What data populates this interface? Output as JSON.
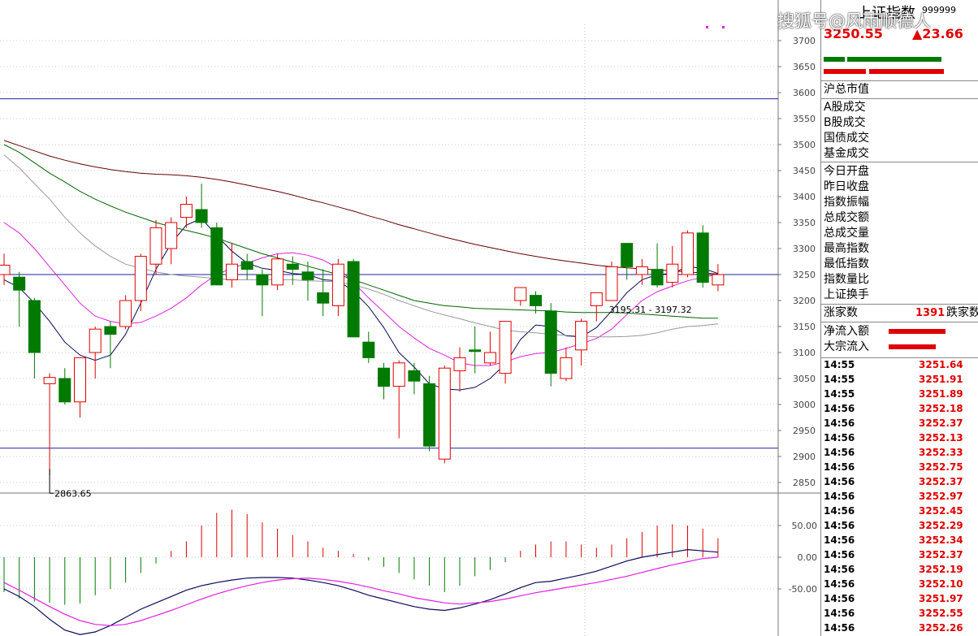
{
  "header": {
    "title": "上证指数",
    "code": "999999",
    "price": "3250.55",
    "change": "▲23.66",
    "indicator_symbols": [
      "◇",
      "◇"
    ]
  },
  "watermark": "搜狐号@风雨顺德人",
  "colors": {
    "up": "#e00000",
    "down": "#007a00",
    "ma_fast": "#0a0a5a",
    "ma_pink": "#e020e0",
    "ma_gray": "#999999",
    "ma_green": "#006600",
    "ma_maroon": "#660000",
    "hline": "#2020a0"
  },
  "panel": {
    "market_labels": [
      "沪总市值",
      "A股成交",
      "B股成交",
      "国债成交",
      "基金成交"
    ],
    "stat_labels": [
      "今日开盘",
      "昨日收盘",
      "指数振幅",
      "总成交额",
      "总成交量",
      "最高指数",
      "最低指数",
      "指数量比",
      "上证换手"
    ],
    "breadth": {
      "up_label": "涨家数",
      "up_value": "1391",
      "down_label": "跌家数"
    },
    "flow_labels": [
      "净流入额",
      "大宗流入"
    ],
    "ticks": [
      {
        "time": "14:55",
        "value": "3251.64"
      },
      {
        "time": "14:55",
        "value": "3251.91"
      },
      {
        "time": "14:55",
        "value": "3251.89"
      },
      {
        "time": "14:56",
        "value": "3252.18"
      },
      {
        "time": "14:56",
        "value": "3252.37"
      },
      {
        "time": "14:56",
        "value": "3252.13"
      },
      {
        "time": "14:56",
        "value": "3252.33"
      },
      {
        "time": "14:56",
        "value": "3252.75"
      },
      {
        "time": "14:56",
        "value": "3252.37"
      },
      {
        "time": "14:56",
        "value": "3252.97"
      },
      {
        "time": "14:56",
        "value": "3252.45"
      },
      {
        "time": "14:56",
        "value": "3252.29"
      },
      {
        "time": "14:56",
        "value": "3252.34"
      },
      {
        "time": "14:56",
        "value": "3252.37"
      },
      {
        "time": "14:56",
        "value": "3252.19"
      },
      {
        "time": "14:56",
        "value": "3252.10"
      },
      {
        "time": "14:56",
        "value": "3251.97"
      },
      {
        "time": "14:56",
        "value": "3252.55"
      },
      {
        "time": "14:56",
        "value": "3252.26"
      }
    ]
  },
  "chart_data": {
    "type": "candlestick",
    "price_axis": {
      "ticks": [
        "3700",
        "3650",
        "3600",
        "3550",
        "3500",
        "3450",
        "3400",
        "3350",
        "3300",
        "3250",
        "3200",
        "3150",
        "3100",
        "3050",
        "3000",
        "2950",
        "2900",
        "2850"
      ],
      "range": [
        2820,
        3730
      ]
    },
    "horizontal_lines": [
      3588,
      3250,
      2916
    ],
    "annotations": [
      {
        "text": "2863.65",
        "at_price": 2863.65,
        "bar": 3
      },
      {
        "text": "3195.31 - 3197.32",
        "at_price": 3200,
        "bar": 41
      }
    ],
    "candles": [
      {
        "o": 3250,
        "h": 3290,
        "l": 3230,
        "c": 3268
      },
      {
        "o": 3245,
        "h": 3255,
        "l": 3150,
        "c": 3220
      },
      {
        "o": 3200,
        "h": 3205,
        "l": 3050,
        "c": 3100
      },
      {
        "o": 3040,
        "h": 3060,
        "l": 2864,
        "c": 3052
      },
      {
        "o": 3050,
        "h": 3070,
        "l": 3000,
        "c": 3005
      },
      {
        "o": 3005,
        "h": 3090,
        "l": 2975,
        "c": 3090
      },
      {
        "o": 3100,
        "h": 3150,
        "l": 3050,
        "c": 3145
      },
      {
        "o": 3150,
        "h": 3160,
        "l": 3070,
        "c": 3135
      },
      {
        "o": 3150,
        "h": 3210,
        "l": 3145,
        "c": 3200
      },
      {
        "o": 3200,
        "h": 3290,
        "l": 3180,
        "c": 3285
      },
      {
        "o": 3270,
        "h": 3355,
        "l": 3250,
        "c": 3340
      },
      {
        "o": 3300,
        "h": 3360,
        "l": 3270,
        "c": 3350
      },
      {
        "o": 3360,
        "h": 3400,
        "l": 3340,
        "c": 3385
      },
      {
        "o": 3375,
        "h": 3425,
        "l": 3340,
        "c": 3350
      },
      {
        "o": 3340,
        "h": 3350,
        "l": 3230,
        "c": 3230
      },
      {
        "o": 3240,
        "h": 3310,
        "l": 3225,
        "c": 3270
      },
      {
        "o": 3275,
        "h": 3290,
        "l": 3240,
        "c": 3260
      },
      {
        "o": 3250,
        "h": 3260,
        "l": 3170,
        "c": 3230
      },
      {
        "o": 3230,
        "h": 3290,
        "l": 3220,
        "c": 3280
      },
      {
        "o": 3270,
        "h": 3285,
        "l": 3230,
        "c": 3260
      },
      {
        "o": 3255,
        "h": 3275,
        "l": 3200,
        "c": 3240
      },
      {
        "o": 3215,
        "h": 3260,
        "l": 3170,
        "c": 3195
      },
      {
        "o": 3190,
        "h": 3280,
        "l": 3170,
        "c": 3270
      },
      {
        "o": 3275,
        "h": 3280,
        "l": 3130,
        "c": 3130
      },
      {
        "o": 3120,
        "h": 3140,
        "l": 3080,
        "c": 3090
      },
      {
        "o": 3070,
        "h": 3080,
        "l": 3010,
        "c": 3035
      },
      {
        "o": 3035,
        "h": 3085,
        "l": 2935,
        "c": 3080
      },
      {
        "o": 3065,
        "h": 3080,
        "l": 3020,
        "c": 3045
      },
      {
        "o": 3040,
        "h": 3055,
        "l": 2910,
        "c": 2920
      },
      {
        "o": 2895,
        "h": 3075,
        "l": 2887,
        "c": 3070
      },
      {
        "o": 3065,
        "h": 3110,
        "l": 3025,
        "c": 3090
      },
      {
        "o": 3105,
        "h": 3150,
        "l": 3060,
        "c": 3102
      },
      {
        "o": 3080,
        "h": 3140,
        "l": 3075,
        "c": 3100
      },
      {
        "o": 3060,
        "h": 3160,
        "l": 3040,
        "c": 3160
      },
      {
        "o": 3200,
        "h": 3225,
        "l": 3190,
        "c": 3225
      },
      {
        "o": 3210,
        "h": 3218,
        "l": 3175,
        "c": 3190
      },
      {
        "o": 3180,
        "h": 3195,
        "l": 3035,
        "c": 3060
      },
      {
        "o": 3050,
        "h": 3110,
        "l": 3045,
        "c": 3090
      },
      {
        "o": 3105,
        "h": 3165,
        "l": 3075,
        "c": 3160
      },
      {
        "o": 3190,
        "h": 3215,
        "l": 3160,
        "c": 3215
      },
      {
        "o": 3200,
        "h": 3275,
        "l": 3200,
        "c": 3265
      },
      {
        "o": 3310,
        "h": 3310,
        "l": 3240,
        "c": 3265
      },
      {
        "o": 3250,
        "h": 3280,
        "l": 3230,
        "c": 3265
      },
      {
        "o": 3260,
        "h": 3310,
        "l": 3225,
        "c": 3230
      },
      {
        "o": 3235,
        "h": 3305,
        "l": 3225,
        "c": 3270
      },
      {
        "o": 3250,
        "h": 3335,
        "l": 3245,
        "c": 3330
      },
      {
        "o": 3330,
        "h": 3345,
        "l": 3225,
        "c": 3235
      },
      {
        "o": 3230,
        "h": 3270,
        "l": 3218,
        "c": 3250
      }
    ],
    "ma_series": [
      {
        "color": "ma_fast",
        "values": [
          3240,
          3225,
          3195,
          3160,
          3120,
          3095,
          3085,
          3095,
          3135,
          3195,
          3260,
          3310,
          3345,
          3358,
          3325,
          3295,
          3272,
          3262,
          3258,
          3252,
          3250,
          3240,
          3238,
          3218,
          3188,
          3148,
          3100,
          3072,
          3040,
          3030,
          3028,
          3033,
          3050,
          3078,
          3125,
          3153,
          3150,
          3132,
          3130,
          3148,
          3180,
          3215,
          3240,
          3250,
          3252,
          3265,
          3262,
          3252
        ]
      },
      {
        "color": "ma_pink",
        "values": [
          3350,
          3330,
          3300,
          3265,
          3230,
          3195,
          3170,
          3160,
          3155,
          3158,
          3170,
          3185,
          3205,
          3230,
          3250,
          3262,
          3272,
          3282,
          3290,
          3292,
          3287,
          3278,
          3262,
          3235,
          3205,
          3178,
          3150,
          3128,
          3108,
          3095,
          3080,
          3075,
          3075,
          3082,
          3092,
          3098,
          3100,
          3108,
          3117,
          3127,
          3145,
          3173,
          3200,
          3217,
          3228,
          3238,
          3245,
          3250
        ]
      },
      {
        "color": "ma_gray",
        "values": [
          3480,
          3455,
          3425,
          3395,
          3360,
          3330,
          3305,
          3285,
          3270,
          3262,
          3255,
          3250,
          3247,
          3245,
          3242,
          3240,
          3240,
          3240,
          3240,
          3240,
          3238,
          3237,
          3236,
          3230,
          3222,
          3212,
          3200,
          3190,
          3180,
          3172,
          3165,
          3157,
          3150,
          3143,
          3140,
          3138,
          3135,
          3133,
          3132,
          3130,
          3130,
          3131,
          3133,
          3138,
          3145,
          3150,
          3152,
          3155
        ]
      },
      {
        "color": "ma_green",
        "values": [
          3500,
          3485,
          3465,
          3445,
          3428,
          3410,
          3395,
          3382,
          3370,
          3360,
          3350,
          3342,
          3335,
          3328,
          3320,
          3310,
          3300,
          3290,
          3282,
          3274,
          3266,
          3258,
          3250,
          3240,
          3230,
          3220,
          3210,
          3200,
          3195,
          3190,
          3188,
          3185,
          3184,
          3183,
          3182,
          3181,
          3180,
          3178,
          3177,
          3177,
          3177,
          3176,
          3174,
          3172,
          3170,
          3168,
          3166,
          3166
        ]
      },
      {
        "color": "ma_maroon",
        "values": [
          3508,
          3498,
          3488,
          3478,
          3470,
          3463,
          3457,
          3452,
          3448,
          3445,
          3443,
          3442,
          3440,
          3437,
          3433,
          3428,
          3422,
          3416,
          3410,
          3403,
          3395,
          3388,
          3380,
          3372,
          3363,
          3355,
          3346,
          3338,
          3330,
          3322,
          3315,
          3308,
          3302,
          3296,
          3290,
          3285,
          3280,
          3276,
          3272,
          3268,
          3265,
          3263,
          3261,
          3259,
          3257,
          3255,
          3253,
          3251
        ]
      }
    ],
    "indicator": {
      "axis_ticks": [
        "50.00",
        "0.00",
        "-50.00"
      ],
      "range": [
        -120,
        75
      ],
      "bars": [
        -55,
        -65,
        -70,
        -72,
        -75,
        -73,
        -60,
        -50,
        -40,
        -25,
        -10,
        10,
        25,
        50,
        70,
        75,
        68,
        55,
        45,
        35,
        25,
        15,
        10,
        5,
        -5,
        -15,
        -25,
        -35,
        -45,
        -55,
        -45,
        -30,
        -20,
        -8,
        10,
        20,
        25,
        25,
        20,
        15,
        20,
        30,
        40,
        50,
        52,
        50,
        45,
        30
      ],
      "dif": [
        -50,
        -62,
        -78,
        -98,
        -115,
        -122,
        -118,
        -108,
        -95,
        -82,
        -72,
        -62,
        -52,
        -45,
        -40,
        -36,
        -33,
        -32,
        -32,
        -33,
        -36,
        -40,
        -45,
        -52,
        -60,
        -66,
        -72,
        -78,
        -82,
        -84,
        -80,
        -74,
        -67,
        -58,
        -48,
        -40,
        -38,
        -33,
        -28,
        -22,
        -14,
        -6,
        0,
        4,
        8,
        12,
        10,
        8
      ],
      "dea": [
        -40,
        -52,
        -65,
        -78,
        -90,
        -100,
        -106,
        -108,
        -106,
        -100,
        -92,
        -84,
        -75,
        -66,
        -58,
        -51,
        -45,
        -40,
        -36,
        -34,
        -33,
        -35,
        -38,
        -42,
        -47,
        -53,
        -58,
        -64,
        -68,
        -72,
        -74,
        -72,
        -70,
        -66,
        -61,
        -56,
        -52,
        -48,
        -44,
        -40,
        -35,
        -30,
        -24,
        -18,
        -12,
        -7,
        -2,
        0
      ]
    }
  }
}
